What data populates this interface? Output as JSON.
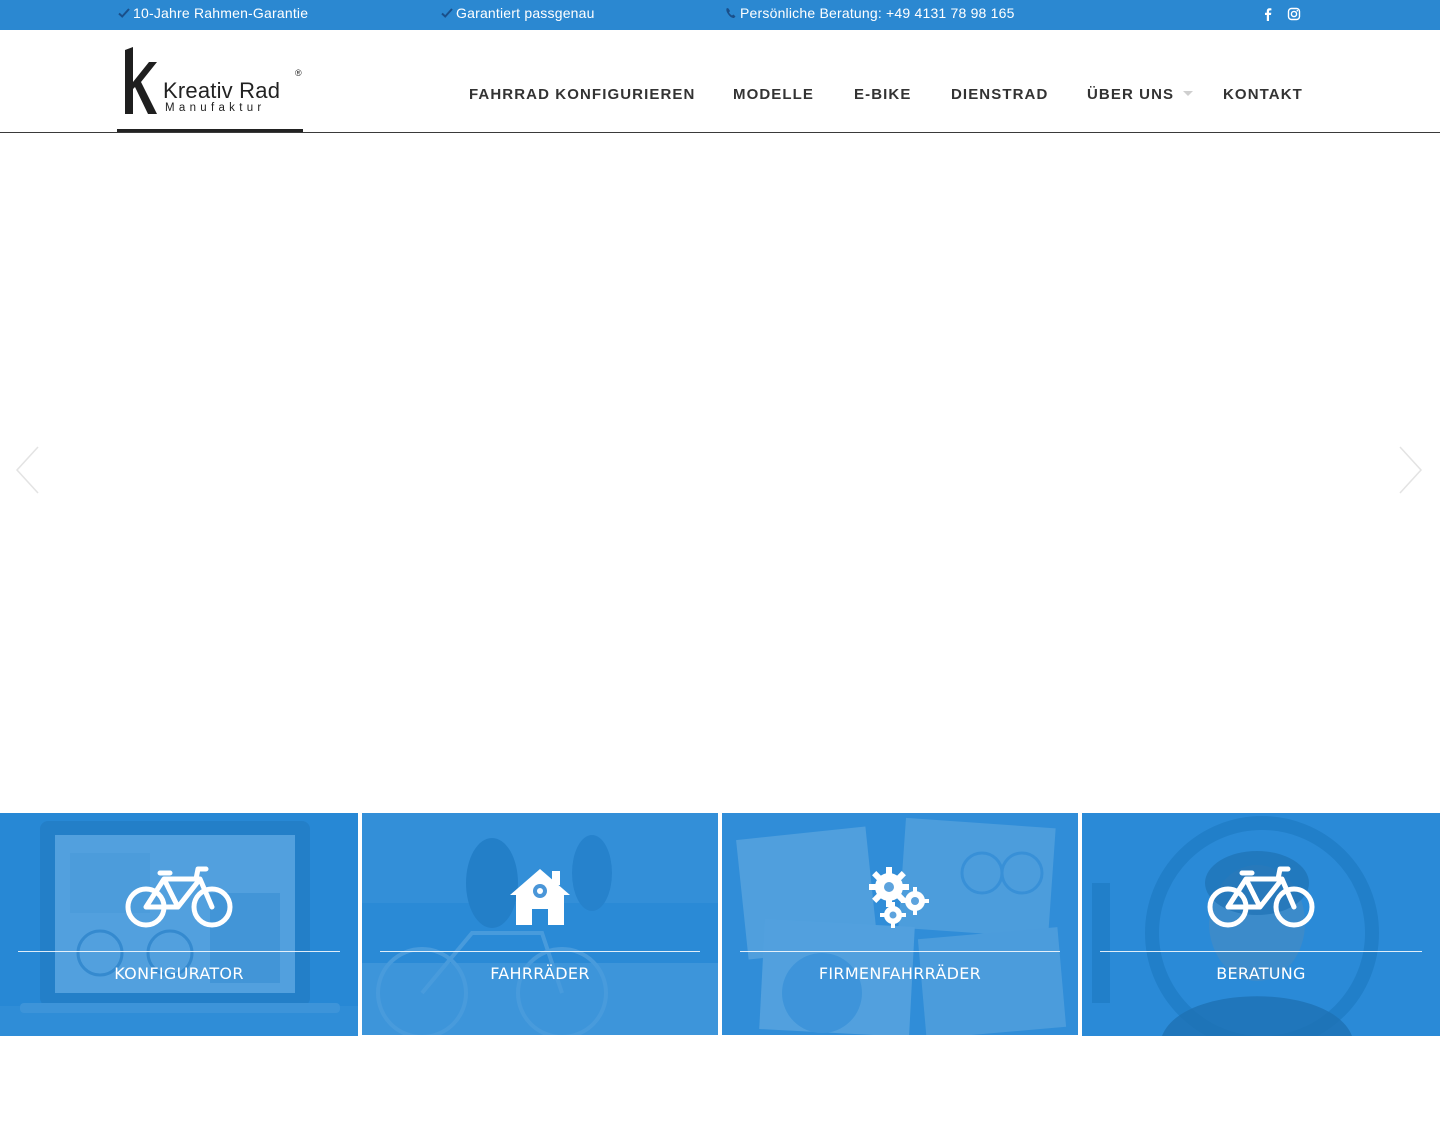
{
  "topbar": {
    "items": [
      {
        "icon": "check-icon",
        "text": "10-Jahre Rahmen-Garantie"
      },
      {
        "icon": "check-icon",
        "text": "Garantiert passgenau"
      },
      {
        "icon": "phone-icon",
        "text": "Persönliche Beratung: +49 4131 78 98 165"
      }
    ],
    "social": [
      "facebook-icon",
      "instagram-icon"
    ],
    "background": "#2b88d1"
  },
  "logo": {
    "title": "Kreativ Rad",
    "subtitle": "Manufaktur",
    "registered": "®"
  },
  "nav": {
    "items": [
      {
        "label": "FAHRRAD KONFIGURIEREN"
      },
      {
        "label": "MODELLE"
      },
      {
        "label": "E-BIKE"
      },
      {
        "label": "DIENSTRAD"
      },
      {
        "label": "ÜBER UNS",
        "has_dropdown": true
      },
      {
        "label": "KONTAKT"
      }
    ]
  },
  "slider": {
    "prev_icon": "chevron-left-icon",
    "next_icon": "chevron-right-icon"
  },
  "tiles": [
    {
      "label": "KONFIGURATOR",
      "icon": "bicycle-icon"
    },
    {
      "label": "FAHRRÄDER",
      "icon": "house-gear-icon"
    },
    {
      "label": "FIRMENFAHRRÄDER",
      "icon": "gears-icon"
    },
    {
      "label": "BERATUNG",
      "icon": "bicycle-icon"
    }
  ],
  "colors": {
    "accent": "#2b88d1",
    "tile_overlay": "#1e85d6",
    "nav_text": "#333333"
  }
}
